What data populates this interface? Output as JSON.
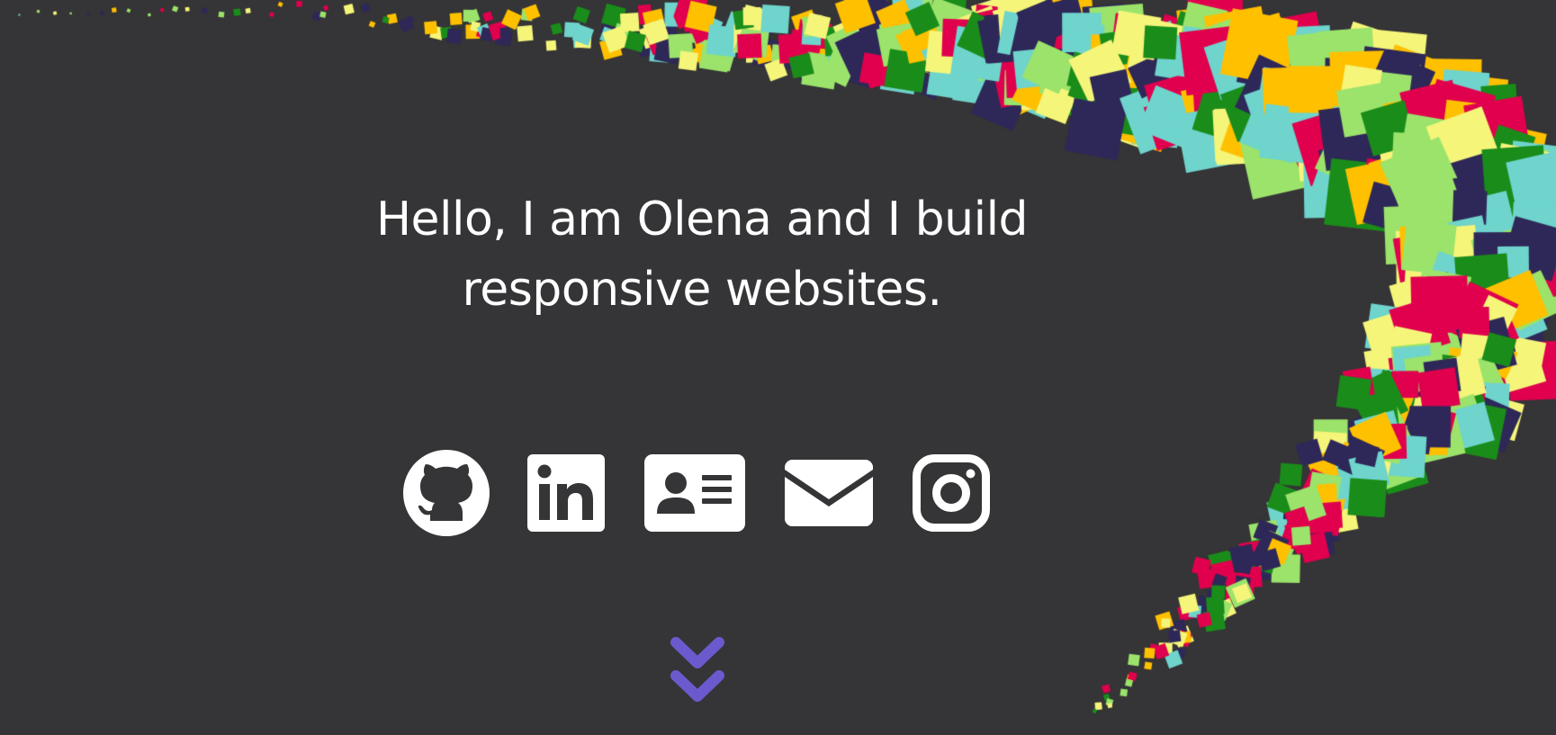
{
  "hero": {
    "headline_line1": "Hello, I am Olena and I build",
    "headline_line2": "responsive websites."
  },
  "social_links": [
    {
      "name": "github",
      "icon": "github-icon",
      "label": "GitHub"
    },
    {
      "name": "linkedin",
      "icon": "linkedin-icon",
      "label": "LinkedIn"
    },
    {
      "name": "resume",
      "icon": "id-card-icon",
      "label": "Resume"
    },
    {
      "name": "email",
      "icon": "envelope-icon",
      "label": "Email"
    },
    {
      "name": "instagram",
      "icon": "instagram-icon",
      "label": "Instagram"
    }
  ],
  "scroll_down": {
    "icon": "double-chevron-down-icon",
    "label": "Scroll down"
  },
  "colors": {
    "background": "#353436",
    "text": "#ffffff",
    "accent": "#6a5acd",
    "confetti": [
      "#e0004d",
      "#ffc000",
      "#f5f57a",
      "#9be36b",
      "#1a8c1a",
      "#6ed4cc",
      "#2e2858"
    ]
  }
}
